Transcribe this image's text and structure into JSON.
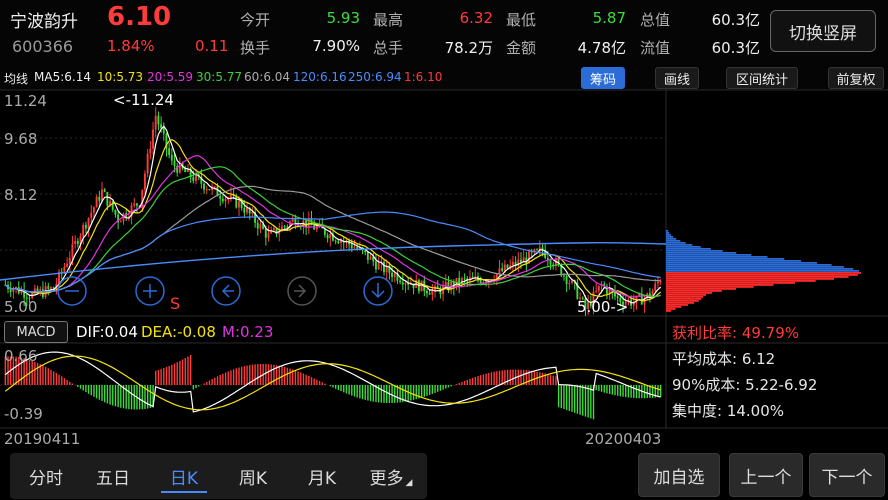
{
  "stock": {
    "name": "宁波韵升",
    "price": "6.10",
    "code": "600366",
    "change_pct": "1.84%",
    "change": "0.11"
  },
  "quote": {
    "open_label": "今开",
    "open": "5.93",
    "high_label": "最高",
    "high": "6.32",
    "low_label": "最低",
    "low": "5.87",
    "total_value_label": "总值",
    "total_value": "60.3亿",
    "turnover_label": "换手",
    "turnover": "7.90%",
    "volume_label": "总手",
    "volume": "78.2万",
    "amount_label": "金额",
    "amount": "4.78亿",
    "float_value_label": "流值",
    "float_value": "60.3亿"
  },
  "switch_button": "切换竖屏",
  "ma": {
    "title": "均线",
    "ma5": "MA5:6.14",
    "ma10": "10:5.73",
    "ma20": "20:5.59",
    "ma30": "30:5.77",
    "ma60": "60:6.04",
    "ma120": "120:6.16",
    "ma250": "250:6.94",
    "ma1": "1:6.10"
  },
  "toolbar": {
    "chips": "筹码",
    "draw": "画线",
    "range": "区间统计",
    "adjust": "前复权"
  },
  "kline": {
    "y_top": "11.24",
    "y_2": "9.68",
    "y_3": "8.12",
    "y_bottom": "5.00",
    "max_marker": "<-11.24",
    "min_marker": "5.00->",
    "sell_marker": "S"
  },
  "macd": {
    "button": "MACD",
    "dif": "DIF:0.04",
    "dea": "DEA:-0.08",
    "m": "M:0.23",
    "y_top": "0.66",
    "y_bottom": "-0.39"
  },
  "dates": {
    "start": "20190411",
    "end": "20200403"
  },
  "chip_stats": {
    "profit": "获利比率: 49.79%",
    "avg_cost": "平均成本: 6.12",
    "cost_90": "90%成本: 5.22-6.92",
    "concentration": "集中度: 14.00%"
  },
  "tabs": [
    "分时",
    "五日",
    "日K",
    "周K",
    "月K",
    "更多"
  ],
  "active_tab": "日K",
  "buttons": {
    "watch": "加自选",
    "prev": "上一个",
    "next": "下一个"
  },
  "colors": {
    "up": "#ff3b3b",
    "down": "#3ddc3d",
    "accent": "#2b6cd6"
  }
}
